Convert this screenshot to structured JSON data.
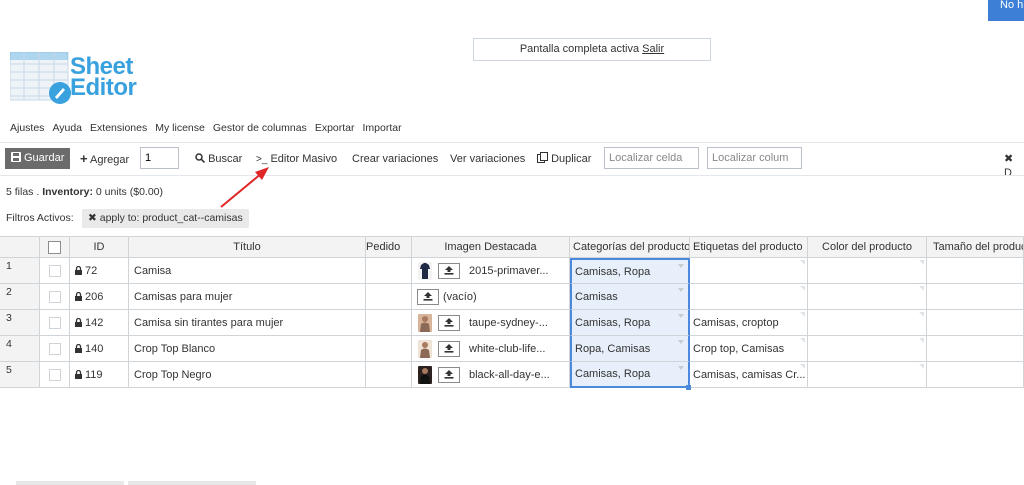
{
  "top_button": "No h",
  "fullscreen": {
    "text": "Pantalla completa activa",
    "exit_link": "Salir"
  },
  "logo": {
    "line1": "Sheet",
    "line2": "Editor"
  },
  "menu": [
    "Ajustes",
    "Ayuda",
    "Extensiones",
    "My license",
    "Gestor de columnas",
    "Exportar",
    "Importar"
  ],
  "toolbar": {
    "save": "Guardar",
    "add": "Agregar",
    "add_count": "1",
    "search": "Buscar",
    "bulk_editor": "Editor Masivo",
    "create_variations": "Crear variaciones",
    "view_variations": "Ver variaciones",
    "duplicate": "Duplicar",
    "locate_cell_placeholder": "Localizar celda",
    "locate_column_placeholder": "Localizar colum",
    "right_action": "D"
  },
  "info": {
    "rows": "5 filas .",
    "inventory_label": "Inventory:",
    "inventory_value": "0 units ($0.00)"
  },
  "filters": {
    "label": "Filtros Activos:",
    "chip": "apply to: product_cat--camisas"
  },
  "columns": {
    "id": "ID",
    "title": "Título",
    "order": "Pedido",
    "image": "Imagen Destacada",
    "categories": "Categorías del producto",
    "tags": "Etiquetas del producto",
    "color": "Color del producto",
    "size": "Tamaño del producto"
  },
  "rows": [
    {
      "num": "1",
      "id": "72",
      "title": "Camisa",
      "image": "2015-primaver...",
      "categories": "Camisas, Ropa",
      "tags": ""
    },
    {
      "num": "2",
      "id": "206",
      "title": "Camisas para mujer",
      "image": "(vacío)",
      "categories": "Camisas",
      "tags": ""
    },
    {
      "num": "3",
      "id": "142",
      "title": "Camisa sin tirantes para mujer",
      "image": "taupe-sydney-...",
      "categories": "Camisas, Ropa",
      "tags": "Camisas, croptop"
    },
    {
      "num": "4",
      "id": "140",
      "title": "Crop Top Blanco",
      "image": "white-club-life...",
      "categories": "Ropa, Camisas",
      "tags": "Crop top, Camisas"
    },
    {
      "num": "5",
      "id": "119",
      "title": "Crop Top Negro",
      "image": "black-all-day-e...",
      "categories": "Camisas, Ropa",
      "tags": "Camisas, camisas Cr..."
    }
  ],
  "colors": {
    "accent": "#4b89dc",
    "logo": "#3aa1df",
    "save_button": "#6b6b6b",
    "arrow": "#e02626"
  }
}
